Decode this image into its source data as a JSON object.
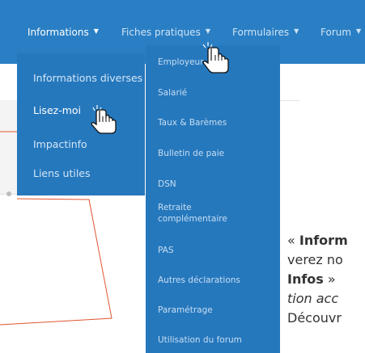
{
  "navbar": {
    "items": [
      {
        "label": "Informations"
      },
      {
        "label": "Fiches pratiques"
      },
      {
        "label": "Formulaires"
      },
      {
        "label": "Forum"
      }
    ]
  },
  "informations_menu": {
    "items": [
      {
        "label": "Informations diverses"
      },
      {
        "label": "Lisez-moi"
      },
      {
        "label": "Impactinfo"
      },
      {
        "label": "Liens utiles"
      }
    ]
  },
  "fiches_menu": {
    "items": [
      {
        "label": "Employeur"
      },
      {
        "label": "Salarié"
      },
      {
        "label": "Taux & Barèmes"
      },
      {
        "label": "Bulletin de paie"
      },
      {
        "label": "DSN"
      },
      {
        "label_line1": "Retraite",
        "label_line2": "complémentaire"
      },
      {
        "label": "PAS"
      },
      {
        "label": "Autres déclarations"
      },
      {
        "label": "Paramétrage"
      },
      {
        "label": "Utilisation du forum"
      }
    ]
  },
  "content": {
    "line1_prefix": "« ",
    "line1_bold": "Inform",
    "line2": "verez no",
    "line3_bold": "Infos",
    "line3_rest": " »",
    "line4": "tion acc",
    "line5": "Découvr"
  },
  "colors": {
    "navbar": "#2a7fc4",
    "dropdown": "#2678bd",
    "sketch_red": "#e0532f"
  }
}
